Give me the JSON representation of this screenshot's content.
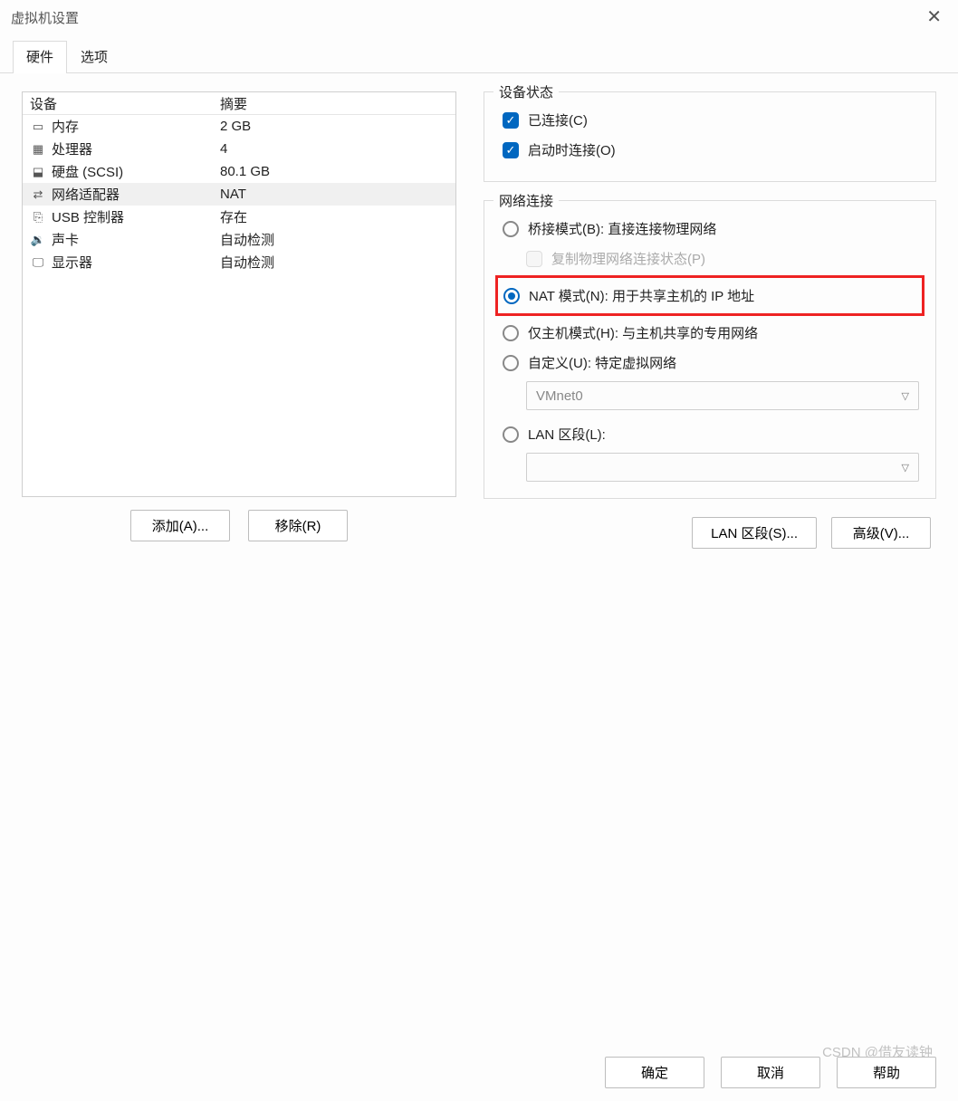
{
  "window": {
    "title": "虚拟机设置"
  },
  "tabs": {
    "hardware": "硬件",
    "options": "选项"
  },
  "table": {
    "header_device": "设备",
    "header_summary": "摘要",
    "rows": [
      {
        "icon": "memory",
        "device": "内存",
        "summary": "2 GB",
        "selected": false
      },
      {
        "icon": "cpu",
        "device": "处理器",
        "summary": "4",
        "selected": false
      },
      {
        "icon": "disk",
        "device": "硬盘 (SCSI)",
        "summary": "80.1 GB",
        "selected": false
      },
      {
        "icon": "network",
        "device": "网络适配器",
        "summary": "NAT",
        "selected": true
      },
      {
        "icon": "usb",
        "device": "USB 控制器",
        "summary": "存在",
        "selected": false
      },
      {
        "icon": "sound",
        "device": "声卡",
        "summary": "自动检测",
        "selected": false
      },
      {
        "icon": "display",
        "device": "显示器",
        "summary": "自动检测",
        "selected": false
      }
    ]
  },
  "left_buttons": {
    "add": "添加(A)...",
    "remove": "移除(R)"
  },
  "device_status": {
    "legend": "设备状态",
    "connected": "已连接(C)",
    "connect_on_start": "启动时连接(O)"
  },
  "network": {
    "legend": "网络连接",
    "bridged": "桥接模式(B): 直接连接物理网络",
    "replicate": "复制物理网络连接状态(P)",
    "nat": "NAT 模式(N): 用于共享主机的 IP 地址",
    "hostonly": "仅主机模式(H): 与主机共享的专用网络",
    "custom": "自定义(U): 特定虚拟网络",
    "custom_select": "VMnet0",
    "lan": "LAN 区段(L):"
  },
  "right_buttons": {
    "lan_segments": "LAN 区段(S)...",
    "advanced": "高级(V)..."
  },
  "footer": {
    "ok": "确定",
    "cancel": "取消",
    "help": "帮助"
  },
  "watermark": "CSDN @借友读钟"
}
